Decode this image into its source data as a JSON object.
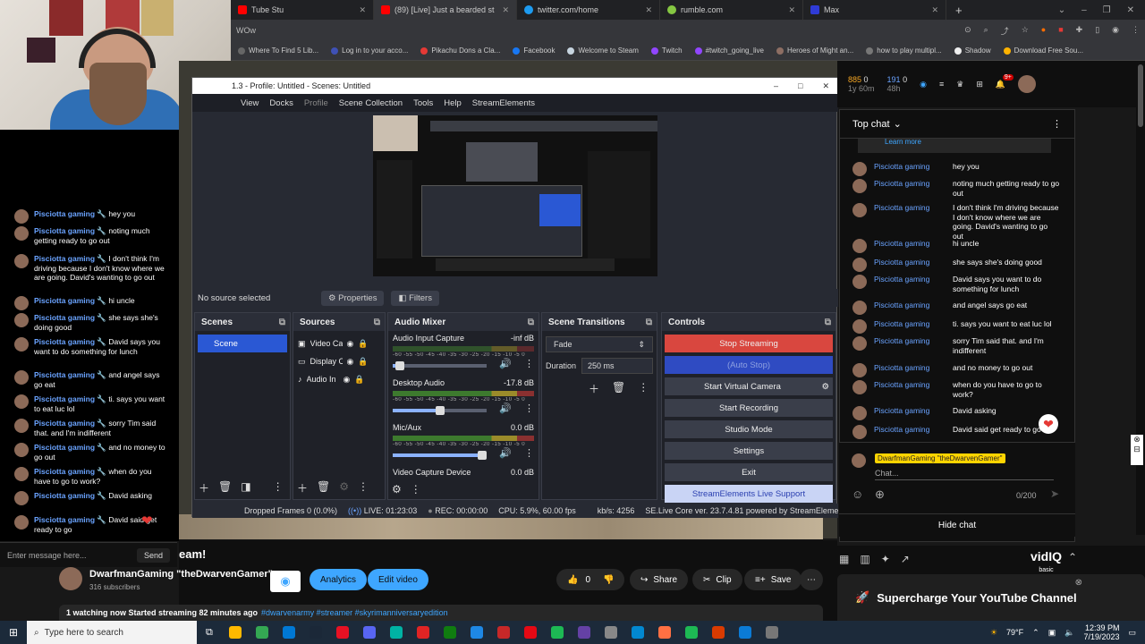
{
  "browser": {
    "tabs": [
      {
        "label": "Tube Stu",
        "color": "#ff0000"
      },
      {
        "label": "(89) [Live] Just a bearded st",
        "color": "#ff0000"
      },
      {
        "label": "twitter.com/home",
        "color": "#1d9bf0"
      },
      {
        "label": "rumble.com",
        "color": "#85c742"
      },
      {
        "label": "Max",
        "color": "#2f3bd6"
      }
    ],
    "new_tab": "+",
    "url_fragment": "WOw",
    "bookmarks": [
      {
        "label": "Where To Find 5 Lib..."
      },
      {
        "label": "Log in to your acco..."
      },
      {
        "label": "Pikachu Dons a Cla..."
      },
      {
        "label": "Facebook"
      },
      {
        "label": "Welcome to Steam"
      },
      {
        "label": "Twitch"
      },
      {
        "label": "#twitch_going_live"
      },
      {
        "label": "Heroes of Might an..."
      },
      {
        "label": "how to play multipl..."
      },
      {
        "label": "Shadow"
      },
      {
        "label": "Download Free Sou..."
      }
    ]
  },
  "left_chat": {
    "messages": [
      {
        "name": "Pisciotta gaming",
        "text": "hey you"
      },
      {
        "name": "Pisciotta gaming",
        "text": "noting much getting ready to go out"
      },
      {
        "name": "Pisciotta gaming",
        "text": "I don't think I'm driving because I don't know where we are going. David's wanting to go out"
      },
      {
        "name": "Pisciotta gaming",
        "text": "hi uncle"
      },
      {
        "name": "Pisciotta gaming",
        "text": "she says she's doing good"
      },
      {
        "name": "Pisciotta gaming",
        "text": "David says you want to do something for lunch"
      },
      {
        "name": "Pisciotta gaming",
        "text": "and angel says go eat"
      },
      {
        "name": "Pisciotta gaming",
        "text": "ti. says you want to eat luc lol"
      },
      {
        "name": "Pisciotta gaming",
        "text": "sorry Tim said that. and I'm indifferent"
      },
      {
        "name": "Pisciotta gaming",
        "text": "and no money to go out"
      },
      {
        "name": "Pisciotta gaming",
        "text": "when do you have to go to work?"
      },
      {
        "name": "Pisciotta gaming",
        "text": "David asking"
      },
      {
        "name": "Pisciotta gaming",
        "text": "David said get ready to go"
      }
    ],
    "input_placeholder": "Enter message here...",
    "send": "Send"
  },
  "obs": {
    "title": "1.3 - Profile: Untitled - Scenes: Untitled",
    "menu": [
      "View",
      "Docks",
      "Profile",
      "Scene Collection",
      "Tools",
      "Help",
      "StreamElements"
    ],
    "no_source": "No source selected",
    "properties": "Properties",
    "filters": "Filters",
    "docks": {
      "scenes": "Scenes",
      "sources": "Sources",
      "mixer": "Audio Mixer",
      "transitions": "Scene Transitions",
      "controls": "Controls"
    },
    "scene_item": "Scene",
    "sources": [
      "Video Ca",
      "Display C",
      "Audio In"
    ],
    "mixer_channels": [
      {
        "name": "Audio Input Capture",
        "db": "-inf dB",
        "level": 0.08
      },
      {
        "name": "Desktop Audio",
        "db": "-17.8 dB",
        "level": 0.5
      },
      {
        "name": "Mic/Aux",
        "db": "0.0 dB",
        "level": 0.95
      },
      {
        "name": "Video Capture Device",
        "db": "0.0 dB",
        "level": 0
      }
    ],
    "tick_scale": "-60 -55 -50 -45 -40 -35 -30 -25 -20 -15 -10 -5 0",
    "transition": "Fade",
    "duration_label": "Duration",
    "duration_value": "250 ms",
    "controls": {
      "stop_streaming": "Stop Streaming",
      "auto_stop": "(Auto Stop)",
      "virtual_camera": "Start Virtual Camera",
      "recording": "Start Recording",
      "studio_mode": "Studio Mode",
      "settings": "Settings",
      "exit": "Exit",
      "support": "StreamElements Live Support"
    },
    "status": {
      "dropped": "Dropped Frames 0 (0.0%)",
      "live": "LIVE: 01:23:03",
      "rec": "REC: 00:00:00",
      "cpu": "CPU: 5.9%, 60.00 fps",
      "kbs": "kb/s: 4256",
      "version": "SE.Live Core ver. 23.7.4.81 powered by StreamElements"
    }
  },
  "right_header": {
    "stat1": "885",
    "stat1_sub": "1y",
    "stat2": "0",
    "stat2_sub": "60m",
    "stat3": "191",
    "stat3_sub": "48h",
    "stat4": "0",
    "notif_count": "9+"
  },
  "right_chat": {
    "header": "Top chat",
    "learn_more": "Learn more",
    "messages": [
      {
        "name": "Pisciotta gaming",
        "text": "hey you"
      },
      {
        "name": "Pisciotta gaming",
        "text": "noting much getting ready to go out"
      },
      {
        "name": "Pisciotta gaming",
        "text": "I don't think I'm driving because I don't know where we are going. David's wanting to go out"
      },
      {
        "name": "Pisciotta gaming",
        "text": "hi uncle"
      },
      {
        "name": "Pisciotta gaming",
        "text": "she says she's doing good"
      },
      {
        "name": "Pisciotta gaming",
        "text": "David says you want to do something for lunch"
      },
      {
        "name": "Pisciotta gaming",
        "text": "and angel says go eat"
      },
      {
        "name": "Pisciotta gaming",
        "text": "ti. says you want to eat luc lol"
      },
      {
        "name": "Pisciotta gaming",
        "text": "sorry Tim said that. and I'm indifferent"
      },
      {
        "name": "Pisciotta gaming",
        "text": "and no money to go out"
      },
      {
        "name": "Pisciotta gaming",
        "text": "when do you have to go to work?"
      },
      {
        "name": "Pisciotta gaming",
        "text": "David asking"
      },
      {
        "name": "Pisciotta gaming",
        "text": "David said get ready to go"
      }
    ],
    "user_badge": "DwarfmanGaming \"theDwarvenGamer\"",
    "input_placeholder": "Chat...",
    "char_count": "0/200",
    "hide_chat": "Hide chat"
  },
  "video": {
    "title_fragment": "eam!",
    "channel": "DwarfmanGaming \"theDwarvenGamer\"",
    "subscribers": "316 subscribers",
    "analytics": "Analytics",
    "edit_video": "Edit video",
    "likes": "0",
    "share": "Share",
    "clip": "Clip",
    "save": "Save",
    "watching": "1 watching now  Started streaming 82 minutes ago",
    "hashtags": "#dwarvenarmy #streamer #skyrimanniversaryedition"
  },
  "vidiq": {
    "logo": "vidIQ",
    "logo_sub": "basic",
    "card": "Supercharge Your YouTube Channel"
  },
  "taskbar": {
    "search_placeholder": "Type here to search",
    "weather": "79°F",
    "time": "12:39 PM",
    "date": "7/19/2023",
    "icon_colors": [
      "#ffb900",
      "#34a853",
      "#0078d4",
      "#1b2838",
      "#e81123",
      "#5865f2",
      "#00b3a4",
      "#e02424",
      "#107c10",
      "#1e88e5",
      "#c62828",
      "#e50914",
      "#1db954",
      "#6441a5",
      "#888888",
      "#0288d1",
      "#ff7043",
      "#1db954",
      "#d83b01",
      "#0b7bd6",
      "#777777"
    ]
  }
}
